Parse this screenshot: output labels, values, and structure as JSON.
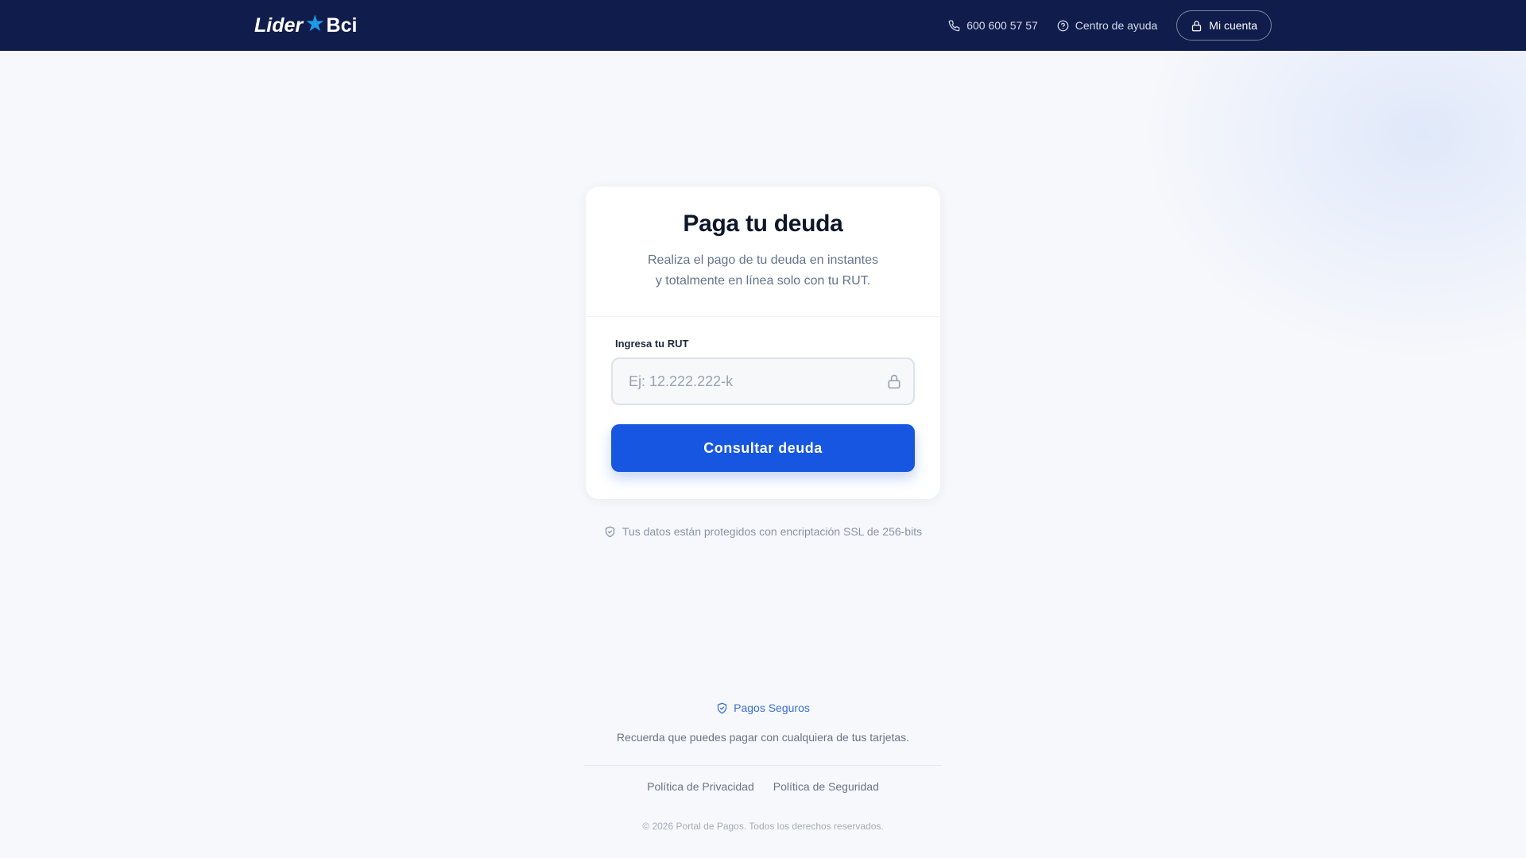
{
  "header": {
    "logo_left": "Lider",
    "logo_star": "★",
    "logo_right": "Bci",
    "phone": "600 600 57 57",
    "help": "Centro de ayuda",
    "account": "Mi cuenta"
  },
  "card": {
    "title": "Paga tu deuda",
    "subtitle_line1": "Realiza el pago de tu deuda en instantes",
    "subtitle_line2": "y totalmente en línea solo con tu RUT.",
    "field_label": "Ingresa tu RUT",
    "input_value": "",
    "input_placeholder": "Ej: 12.222.222-k",
    "submit": "Consultar deuda"
  },
  "ssl_note": "Tus datos están protegidos con encriptación SSL de 256-bits",
  "footer": {
    "badge": "Pagos Seguros",
    "text": "Recuerda que puedes pagar con cualquiera de tus tarjetas.",
    "links": [
      "Política de Privacidad",
      "Política de Seguridad"
    ],
    "copyright": "© 2026 Portal de Pagos. Todos los derechos reservados."
  },
  "colors": {
    "header_bg": "#101d4c",
    "accent_star": "#1e9be8",
    "primary_button": "#1656e0",
    "badge_blue": "#3a6fd8"
  },
  "icons": {
    "phone": "phone-icon",
    "help": "help-circle-icon",
    "account": "lock-icon",
    "input": "lock-icon",
    "ssl": "shield-check-icon",
    "badge": "shield-check-icon"
  }
}
